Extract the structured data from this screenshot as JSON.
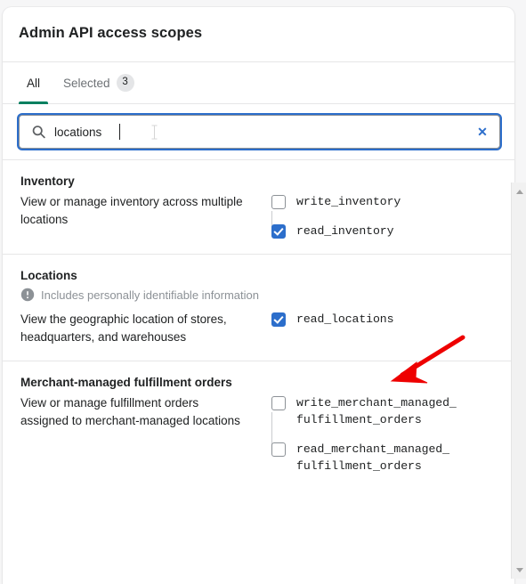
{
  "header": {
    "title": "Admin API access scopes"
  },
  "tabs": [
    {
      "label": "All",
      "badge": "",
      "active": true
    },
    {
      "label": "Selected",
      "badge": "3",
      "active": false
    }
  ],
  "search": {
    "value": "locations",
    "placeholder": "Search",
    "icon": "search-icon",
    "clear_label": "✕"
  },
  "sections": [
    {
      "title": "Inventory",
      "pii": null,
      "description": "View or manage inventory across multiple locations",
      "scopes": [
        {
          "label": "write_inventory",
          "checked": false
        },
        {
          "label": "read_inventory",
          "checked": true
        }
      ]
    },
    {
      "title": "Locations",
      "pii": "Includes personally identifiable information",
      "description": "View the geographic location of stores, headquarters, and warehouses",
      "scopes": [
        {
          "label": "read_locations",
          "checked": true
        }
      ]
    },
    {
      "title": "Merchant-managed fulfillment orders",
      "pii": null,
      "description": "View or manage fulfillment orders assigned to merchant-managed locations",
      "scopes": [
        {
          "label": "write_merchant_managed_\nfulfillment_orders",
          "checked": false
        },
        {
          "label": "read_merchant_managed_\nfulfillment_orders",
          "checked": false
        }
      ]
    }
  ],
  "annotation": {
    "type": "arrow",
    "color": "#ee0000",
    "points_to": "read_locations"
  },
  "colors": {
    "accent_tab": "#008060",
    "checkbox_checked": "#2c6ecb",
    "focus_ring": "#2c6ecb",
    "page_background": "#f6f6f7",
    "card_background": "#ffffff",
    "divider": "#e6e6e7",
    "muted_text": "#8c9196"
  }
}
